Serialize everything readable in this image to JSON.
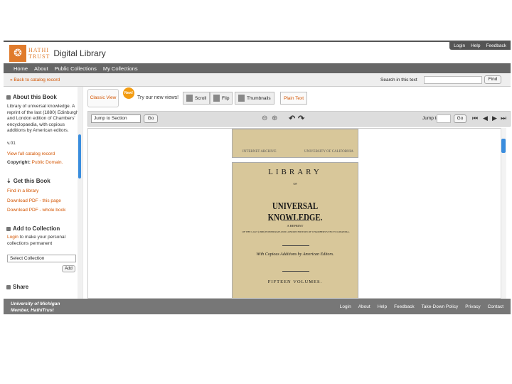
{
  "header": {
    "logo_text_1": "HATHI",
    "logo_text_2": "TRUST",
    "title": "Digital Library",
    "toplinks": [
      "Login",
      "Help",
      "Feedback"
    ]
  },
  "nav": {
    "items": [
      "Home",
      "About",
      "Public Collections",
      "My Collections"
    ]
  },
  "subbar": {
    "back_link": "« Back to catalog record",
    "search_label": "Search in this text",
    "search_value": "",
    "find_button": "Find"
  },
  "sidebar": {
    "about": {
      "heading": "About this Book",
      "description": "Library of universal knowledge. A reprint of the last (1880) Edinburgh and London edition of Chambers' encyclopaedia, with copious additions by American editors.",
      "volume": "v.01",
      "catalog_link": "View full catalog record",
      "copyright_label": "Copyright:",
      "copyright_value": "Public Domain."
    },
    "get": {
      "heading": "Get this Book",
      "links": [
        "Find in a library",
        "Download PDF - this page",
        "Download PDF - whole book"
      ]
    },
    "collection": {
      "heading": "Add to Collection",
      "login": "Login",
      "text": " to make your personal collections permanent",
      "select": "Select Collection",
      "add_button": "Add"
    },
    "share": {
      "heading": "Share"
    }
  },
  "viewbar": {
    "classic": "Classic View",
    "new_badge": "New!",
    "try_text": "Try our new views!",
    "modes": [
      "Scroll",
      "Flip",
      "Thumbnails"
    ],
    "plain": "Plain Text"
  },
  "readerbar": {
    "jump_section": "Jump to Section",
    "go": "Go",
    "jump_label": "Jump to",
    "jump_value": "",
    "go2": "Go"
  },
  "page_prev": {
    "wm_left": "INTERNET ARCHIVE",
    "wm_right": "UNIVERSITY OF CALIFORNIA"
  },
  "page": {
    "title": "LIBRARY",
    "of": "OF",
    "main": "UNIVERSAL KNOWLEDGE.",
    "reprint": "A REPRINT",
    "reprint_desc": "OF THE LAST (1880) EDINBURGH AND LONDON EDITION OF CHAMBERS'S ENCYCLOPAEDIA.",
    "additions": "With Copious Additions by American Editors.",
    "volumes": "FIFTEEN VOLUMES."
  },
  "footer": {
    "left_1": "University of Michigan",
    "left_2": "Member, HathiTrust",
    "links": [
      "Login",
      "About",
      "Help",
      "Feedback",
      "Take-Down Policy",
      "Privacy",
      "Contact"
    ]
  }
}
